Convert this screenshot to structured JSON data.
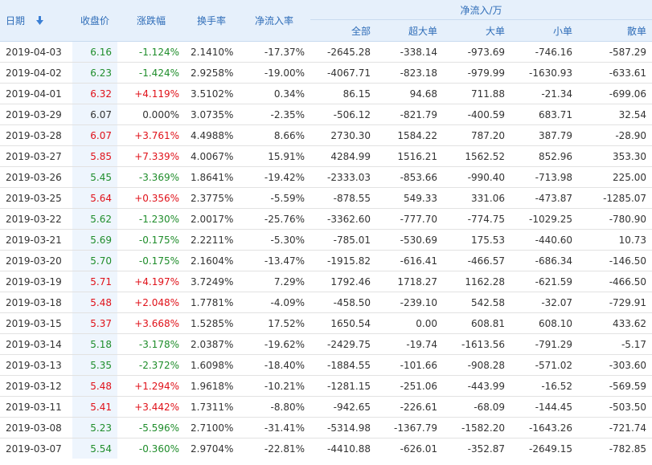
{
  "header": {
    "date": "日期",
    "close": "收盘价",
    "change": "涨跌幅",
    "turnover": "换手率",
    "net_rate": "净流入率",
    "net_group": "净流入/万",
    "all": "全部",
    "super_large": "超大单",
    "large": "大单",
    "small": "小单",
    "retail": "散单"
  },
  "colors": {
    "up": "#e0121a",
    "down": "#1f8d2b",
    "header_bg": "#e6f0fb",
    "header_text": "#2f6db8",
    "close_bg": "#eef5fd"
  },
  "icons": {
    "sort": "sort-down-arrow-icon"
  },
  "rows": [
    {
      "date": "2019-04-03",
      "close": "6.16",
      "change": "-1.124%",
      "dir": "down",
      "turnover": "2.1410%",
      "rate": "-17.37%",
      "all": "-2645.28",
      "super": "-338.14",
      "large": "-973.69",
      "small": "-746.16",
      "retail": "-587.29"
    },
    {
      "date": "2019-04-02",
      "close": "6.23",
      "change": "-1.424%",
      "dir": "down",
      "turnover": "2.9258%",
      "rate": "-19.00%",
      "all": "-4067.71",
      "super": "-823.18",
      "large": "-979.99",
      "small": "-1630.93",
      "retail": "-633.61"
    },
    {
      "date": "2019-04-01",
      "close": "6.32",
      "change": "+4.119%",
      "dir": "up",
      "turnover": "3.5102%",
      "rate": "0.34%",
      "all": "86.15",
      "super": "94.68",
      "large": "711.88",
      "small": "-21.34",
      "retail": "-699.06"
    },
    {
      "date": "2019-03-29",
      "close": "6.07",
      "change": "0.000%",
      "dir": "flat",
      "turnover": "3.0735%",
      "rate": "-2.35%",
      "all": "-506.12",
      "super": "-821.79",
      "large": "-400.59",
      "small": "683.71",
      "retail": "32.54"
    },
    {
      "date": "2019-03-28",
      "close": "6.07",
      "change": "+3.761%",
      "dir": "up",
      "turnover": "4.4988%",
      "rate": "8.66%",
      "all": "2730.30",
      "super": "1584.22",
      "large": "787.20",
      "small": "387.79",
      "retail": "-28.90"
    },
    {
      "date": "2019-03-27",
      "close": "5.85",
      "change": "+7.339%",
      "dir": "up",
      "turnover": "4.0067%",
      "rate": "15.91%",
      "all": "4284.99",
      "super": "1516.21",
      "large": "1562.52",
      "small": "852.96",
      "retail": "353.30"
    },
    {
      "date": "2019-03-26",
      "close": "5.45",
      "change": "-3.369%",
      "dir": "down",
      "turnover": "1.8641%",
      "rate": "-19.42%",
      "all": "-2333.03",
      "super": "-853.66",
      "large": "-990.40",
      "small": "-713.98",
      "retail": "225.00"
    },
    {
      "date": "2019-03-25",
      "close": "5.64",
      "change": "+0.356%",
      "dir": "up",
      "turnover": "2.3775%",
      "rate": "-5.59%",
      "all": "-878.55",
      "super": "549.33",
      "large": "331.06",
      "small": "-473.87",
      "retail": "-1285.07"
    },
    {
      "date": "2019-03-22",
      "close": "5.62",
      "change": "-1.230%",
      "dir": "down",
      "turnover": "2.0017%",
      "rate": "-25.76%",
      "all": "-3362.60",
      "super": "-777.70",
      "large": "-774.75",
      "small": "-1029.25",
      "retail": "-780.90"
    },
    {
      "date": "2019-03-21",
      "close": "5.69",
      "change": "-0.175%",
      "dir": "down",
      "turnover": "2.2211%",
      "rate": "-5.30%",
      "all": "-785.01",
      "super": "-530.69",
      "large": "175.53",
      "small": "-440.60",
      "retail": "10.73"
    },
    {
      "date": "2019-03-20",
      "close": "5.70",
      "change": "-0.175%",
      "dir": "down",
      "turnover": "2.1604%",
      "rate": "-13.47%",
      "all": "-1915.82",
      "super": "-616.41",
      "large": "-466.57",
      "small": "-686.34",
      "retail": "-146.50"
    },
    {
      "date": "2019-03-19",
      "close": "5.71",
      "change": "+4.197%",
      "dir": "up",
      "turnover": "3.7249%",
      "rate": "7.29%",
      "all": "1792.46",
      "super": "1718.27",
      "large": "1162.28",
      "small": "-621.59",
      "retail": "-466.50"
    },
    {
      "date": "2019-03-18",
      "close": "5.48",
      "change": "+2.048%",
      "dir": "up",
      "turnover": "1.7781%",
      "rate": "-4.09%",
      "all": "-458.50",
      "super": "-239.10",
      "large": "542.58",
      "small": "-32.07",
      "retail": "-729.91"
    },
    {
      "date": "2019-03-15",
      "close": "5.37",
      "change": "+3.668%",
      "dir": "up",
      "turnover": "1.5285%",
      "rate": "17.52%",
      "all": "1650.54",
      "super": "0.00",
      "large": "608.81",
      "small": "608.10",
      "retail": "433.62"
    },
    {
      "date": "2019-03-14",
      "close": "5.18",
      "change": "-3.178%",
      "dir": "down",
      "turnover": "2.0387%",
      "rate": "-19.62%",
      "all": "-2429.75",
      "super": "-19.74",
      "large": "-1613.56",
      "small": "-791.29",
      "retail": "-5.17"
    },
    {
      "date": "2019-03-13",
      "close": "5.35",
      "change": "-2.372%",
      "dir": "down",
      "turnover": "1.6098%",
      "rate": "-18.40%",
      "all": "-1884.55",
      "super": "-101.66",
      "large": "-908.28",
      "small": "-571.02",
      "retail": "-303.60"
    },
    {
      "date": "2019-03-12",
      "close": "5.48",
      "change": "+1.294%",
      "dir": "up",
      "turnover": "1.9618%",
      "rate": "-10.21%",
      "all": "-1281.15",
      "super": "-251.06",
      "large": "-443.99",
      "small": "-16.52",
      "retail": "-569.59"
    },
    {
      "date": "2019-03-11",
      "close": "5.41",
      "change": "+3.442%",
      "dir": "up",
      "turnover": "1.7311%",
      "rate": "-8.80%",
      "all": "-942.65",
      "super": "-226.61",
      "large": "-68.09",
      "small": "-144.45",
      "retail": "-503.50"
    },
    {
      "date": "2019-03-08",
      "close": "5.23",
      "change": "-5.596%",
      "dir": "down",
      "turnover": "2.7100%",
      "rate": "-31.41%",
      "all": "-5314.98",
      "super": "-1367.79",
      "large": "-1582.20",
      "small": "-1643.26",
      "retail": "-721.74"
    },
    {
      "date": "2019-03-07",
      "close": "5.54",
      "change": "-0.360%",
      "dir": "down",
      "turnover": "2.9704%",
      "rate": "-22.81%",
      "all": "-4410.88",
      "super": "-626.01",
      "large": "-352.87",
      "small": "-2649.15",
      "retail": "-782.85"
    }
  ]
}
